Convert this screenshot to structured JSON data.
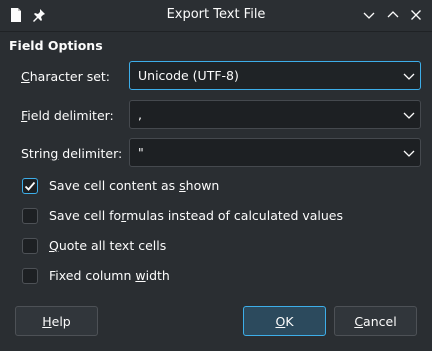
{
  "window": {
    "title": "Export Text File",
    "controls": [
      "minimize",
      "maximize",
      "close"
    ]
  },
  "section": {
    "title": "Field Options"
  },
  "fields": [
    {
      "label_prefix": "",
      "label_mnemonic": "C",
      "label_rest": "haracter set:",
      "value": "Unicode (UTF-8)"
    },
    {
      "label_prefix": "",
      "label_mnemonic": "F",
      "label_rest": "ield delimiter:",
      "value": ","
    },
    {
      "label_prefix": "Strin",
      "label_mnemonic": "g",
      "label_rest": " delimiter:",
      "value": "\""
    }
  ],
  "checkboxes": [
    {
      "pre": "Save cell content as ",
      "mn": "s",
      "post": "hown",
      "checked": true
    },
    {
      "pre": "Save cell fo",
      "mn": "r",
      "post": "mulas instead of calculated values",
      "checked": false
    },
    {
      "pre": "",
      "mn": "Q",
      "post": "uote all text cells",
      "checked": false
    },
    {
      "pre": "Fixed column ",
      "mn": "w",
      "post": "idth",
      "checked": false
    }
  ],
  "buttons": {
    "help": {
      "mn": "H",
      "rest": "elp"
    },
    "ok": {
      "mn": "O",
      "rest": "K"
    },
    "cancel": {
      "mn": "C",
      "rest": "ancel"
    }
  },
  "colors": {
    "accent": "#3daee9",
    "background": "#2a2e32",
    "field": "#1d2023"
  }
}
